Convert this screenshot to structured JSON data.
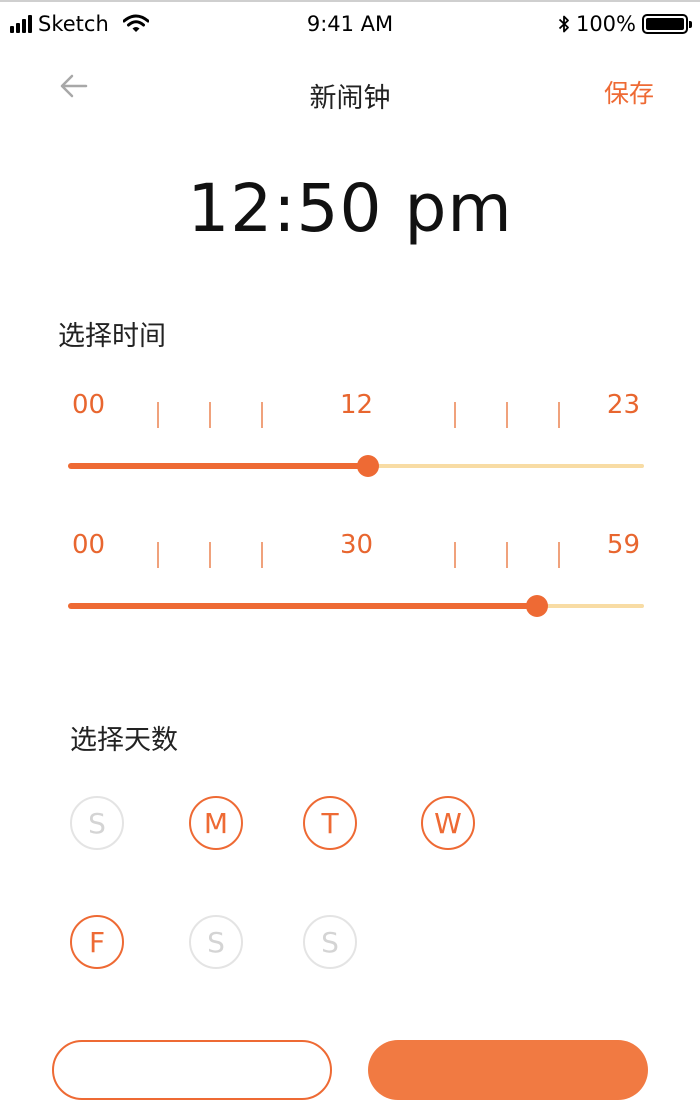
{
  "status_bar": {
    "carrier": "Sketch",
    "time": "9:41 AM",
    "battery": "100%"
  },
  "nav": {
    "title": "新闹钟",
    "save_label": "保存",
    "back_icon": "arrow-left-icon"
  },
  "display_time": "12:50 pm",
  "time_section": {
    "label": "选择时间",
    "hour_slider": {
      "min_label": "00",
      "mid_label": "12",
      "max_label": "23",
      "value_fraction": 0.52
    },
    "minute_slider": {
      "min_label": "00",
      "mid_label": "30",
      "max_label": "59",
      "value_fraction": 0.815
    }
  },
  "days_section": {
    "label": "选择天数",
    "days": [
      {
        "label": "S",
        "selected": false
      },
      {
        "label": "M",
        "selected": true
      },
      {
        "label": "T",
        "selected": true
      },
      {
        "label": "W",
        "selected": true
      },
      {
        "label": "F",
        "selected": true
      },
      {
        "label": "S",
        "selected": false
      },
      {
        "label": "S",
        "selected": false
      }
    ]
  },
  "colors": {
    "accent": "#ee6a34",
    "track": "#f8dca4",
    "inactive": "#e4e4e4"
  }
}
